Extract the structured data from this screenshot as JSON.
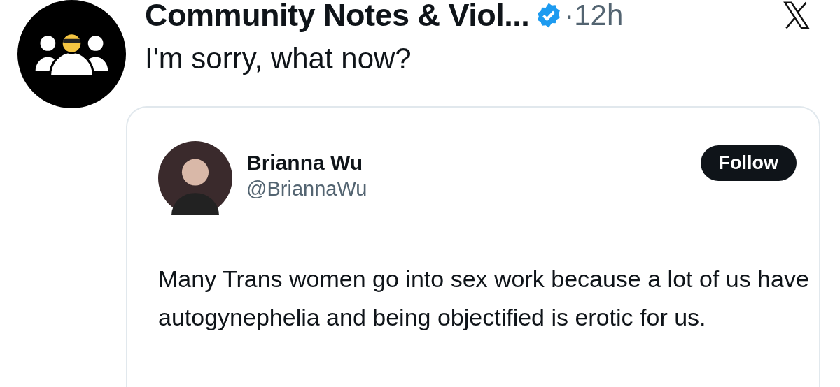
{
  "post": {
    "author": "Community Notes & Viol...",
    "verified": true,
    "time": "·12h",
    "text": "I'm sorry, what now?"
  },
  "quoted_post": {
    "author": "Brianna Wu",
    "handle": "@BriannaWu",
    "follow_button": "Follow",
    "text": "Many Trans women go into sex work because a lot of us have autogynephelia and being objectified is erotic for us."
  }
}
